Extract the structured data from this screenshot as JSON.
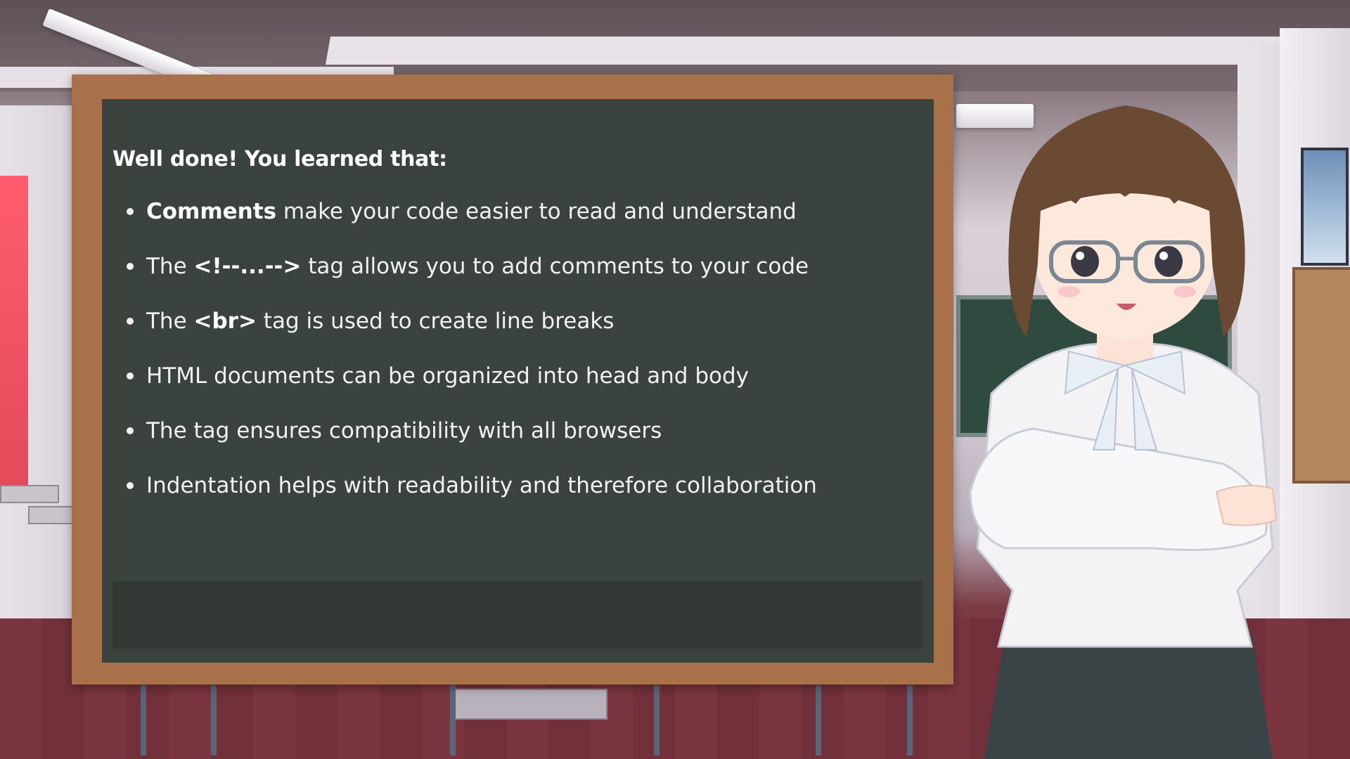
{
  "lesson_board": {
    "title": "Well done! You learned that:",
    "points": [
      {
        "bold_lead": "",
        "prefix": "",
        "bold": "Comments",
        "text": " make your code easier to read and understand"
      },
      {
        "prefix": "The ",
        "bold": "<!--...-->",
        "text": " tag allows you to add comments to your code"
      },
      {
        "prefix": "The ",
        "bold": "<br>",
        "text": " tag is used to create line breaks"
      },
      {
        "prefix": "",
        "bold": "",
        "text": "HTML documents can be organized into head and body"
      },
      {
        "prefix": "",
        "bold": "",
        "text": "The tag ensures compatibility with all browsers"
      },
      {
        "prefix": "",
        "bold": "",
        "text": "Indentation helps with readability and therefore collaboration"
      }
    ],
    "dialog_text": ""
  },
  "colors": {
    "board": "#3a433d",
    "frame": "#a8714a",
    "text": "#f2f2ef",
    "dialog_box": "#323834"
  },
  "character": {
    "icon": "teacher-character-icon"
  }
}
